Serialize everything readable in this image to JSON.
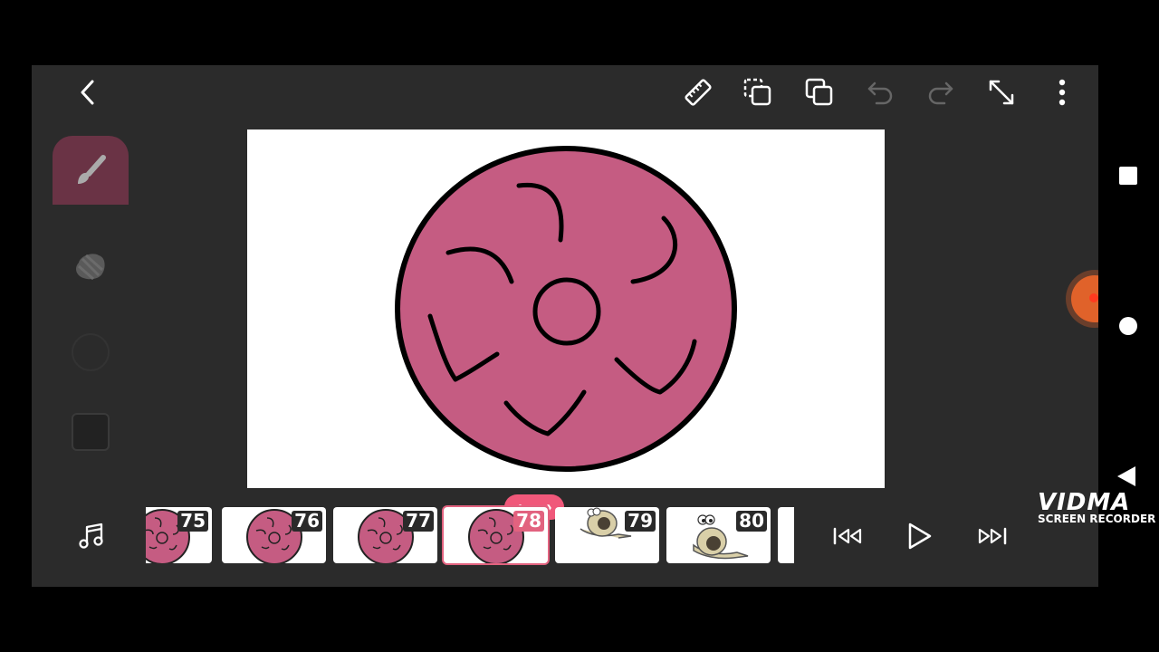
{
  "toolbar": {
    "back": "back-icon",
    "ruler": "ruler-icon",
    "layers": "layers-icon",
    "duplicate": "duplicate-icon",
    "undo": "undo-icon",
    "redo": "redo-icon",
    "fullscreen": "fullscreen-icon",
    "more": "more-options-icon"
  },
  "tools": [
    {
      "name": "brush",
      "icon": "brush-icon",
      "selected": true
    },
    {
      "name": "eraser",
      "icon": "eraser-icon",
      "selected": false
    },
    {
      "name": "brush-size",
      "icon": "circle-icon",
      "selected": false
    },
    {
      "name": "color",
      "icon": "color-swatch-icon",
      "selected": false
    }
  ],
  "canvas": {
    "fill_color": "#c55c82",
    "stroke_color": "#000000"
  },
  "timeline": {
    "frames": [
      {
        "number": "75",
        "type": "disc",
        "selected": false
      },
      {
        "number": "76",
        "type": "disc",
        "selected": false
      },
      {
        "number": "77",
        "type": "disc",
        "selected": false
      },
      {
        "number": "78",
        "type": "disc",
        "selected": true
      },
      {
        "number": "79",
        "type": "snail",
        "selected": false
      },
      {
        "number": "80",
        "type": "snail",
        "selected": false
      }
    ],
    "nav_prev": "‹",
    "nav_next": "›"
  },
  "playback": {
    "music": "music-icon",
    "first": "skip-to-start-icon",
    "play": "play-icon",
    "last": "skip-to-end-icon"
  },
  "watermark": {
    "logo": "VIDMA",
    "sub": "SCREEN RECORDER"
  },
  "colors": {
    "accent": "#e2627f",
    "app_bg": "#2b2b2b",
    "pink": "#c55c82"
  }
}
